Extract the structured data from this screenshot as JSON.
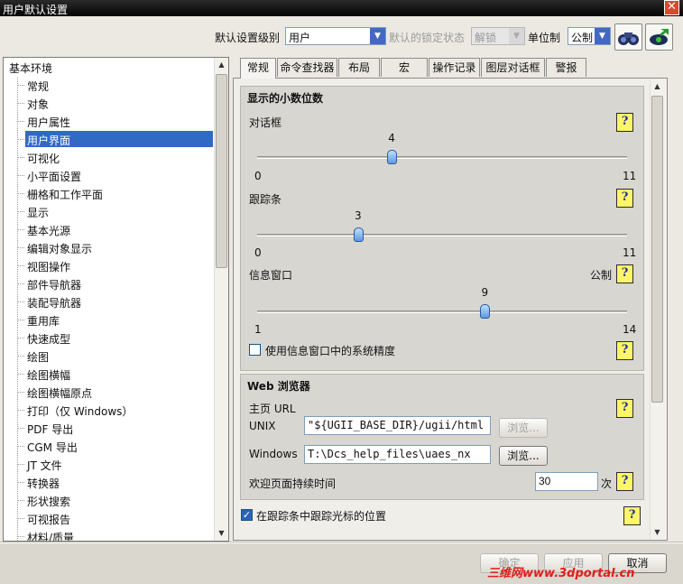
{
  "window": {
    "title": "用户默认设置",
    "close_glyph": "✕"
  },
  "topbar": {
    "level_label": "默认设置级别",
    "level_value": "用户",
    "lock_label": "默认的锁定状态",
    "lock_value": "解锁",
    "unit_label": "单位制",
    "unit_value": "公制"
  },
  "tree": {
    "root": "基本环境",
    "items": [
      "常规",
      "对象",
      "用户属性",
      "用户界面",
      "可视化",
      "小平面设置",
      "栅格和工作平面",
      "显示",
      "基本光源",
      "编辑对象显示",
      "视图操作",
      "部件导航器",
      "装配导航器",
      "重用库",
      "快速成型",
      "绘图",
      "绘图横幅",
      "绘图横幅原点",
      "打印（仅 Windows）",
      "PDF 导出",
      "CGM 导出",
      "JT 文件",
      "转换器",
      "形状搜索",
      "可视报告",
      "材料/质量"
    ],
    "selected_index": 3
  },
  "tabs": [
    "常规",
    "命令查找器",
    "布局",
    "宏",
    "操作记录",
    "图层对话框",
    "警报"
  ],
  "decimals": {
    "title": "显示的小数位数",
    "dialog": {
      "label": "对话框",
      "value": 4,
      "min": "0",
      "max": "11"
    },
    "tracker": {
      "label": "跟踪条",
      "value": 3,
      "min": "0",
      "max": "11"
    },
    "info": {
      "label": "信息窗口",
      "unit": "公制",
      "value": 9,
      "min": "1",
      "max": "14"
    },
    "system_precision_label": "使用信息窗口中的系统精度",
    "system_precision_checked": false
  },
  "web": {
    "title": "Web 浏览器",
    "home_label": "主页 URL",
    "unix_label": "UNIX",
    "unix_value": "\"${UGII_BASE_DIR}/ugii/html",
    "unix_browse": "浏览...",
    "windows_label": "Windows",
    "windows_value": "T:\\Dcs_help_files\\uaes_nx",
    "windows_browse": "浏览...",
    "welcome_label": "欢迎页面持续时间",
    "welcome_value": "30",
    "welcome_unit": "次"
  },
  "tracker_cursor": {
    "label": "在跟踪条中跟踪光标的位置",
    "checked": true
  },
  "help_glyph": "?",
  "buttons": {
    "ok": "确定",
    "apply": "应用",
    "cancel": "取消"
  },
  "watermark": "三维网www.3dportal.cn"
}
